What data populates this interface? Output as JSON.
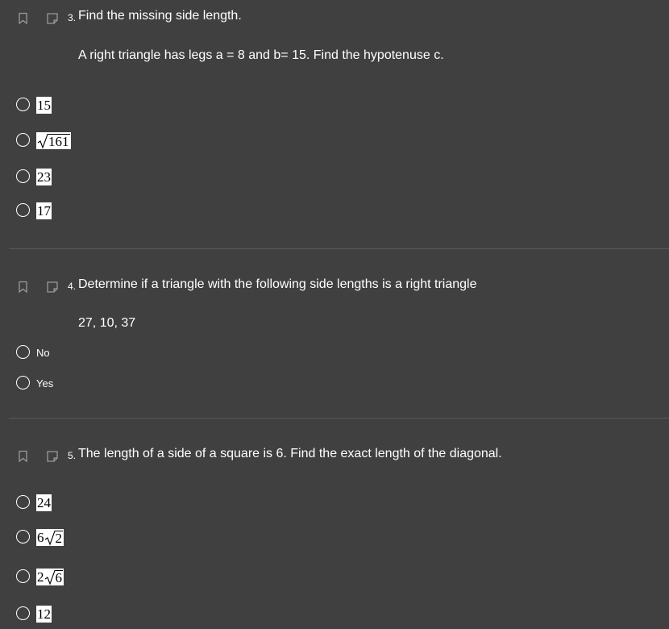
{
  "questions": [
    {
      "number": "3.",
      "title": "Find the missing side length.",
      "body": "A right triangle has legs a = 8 and b= 15.  Find the hypotenuse c.",
      "options": [
        {
          "coef": "15",
          "radicand": ""
        },
        {
          "coef": "",
          "radicand": "161"
        },
        {
          "coef": "23",
          "radicand": ""
        },
        {
          "coef": "17",
          "radicand": ""
        }
      ]
    },
    {
      "number": "4.",
      "title": "Determine if a triangle with the following side lengths is a right triangle",
      "body": "27, 10, 37",
      "options": [
        {
          "label": "No"
        },
        {
          "label": "Yes"
        }
      ]
    },
    {
      "number": "5.",
      "title": "The length of a side of a square is 6. Find the exact length of the diagonal.",
      "body": "",
      "options": [
        {
          "coef": "24",
          "radicand": ""
        },
        {
          "coef": "6",
          "radicand": "2"
        },
        {
          "coef": "2",
          "radicand": "6"
        },
        {
          "coef": "12",
          "radicand": ""
        }
      ]
    }
  ],
  "icons": {
    "bookmark": "bookmark-icon",
    "note": "note-icon",
    "icon_color": "#9a9a9a"
  }
}
